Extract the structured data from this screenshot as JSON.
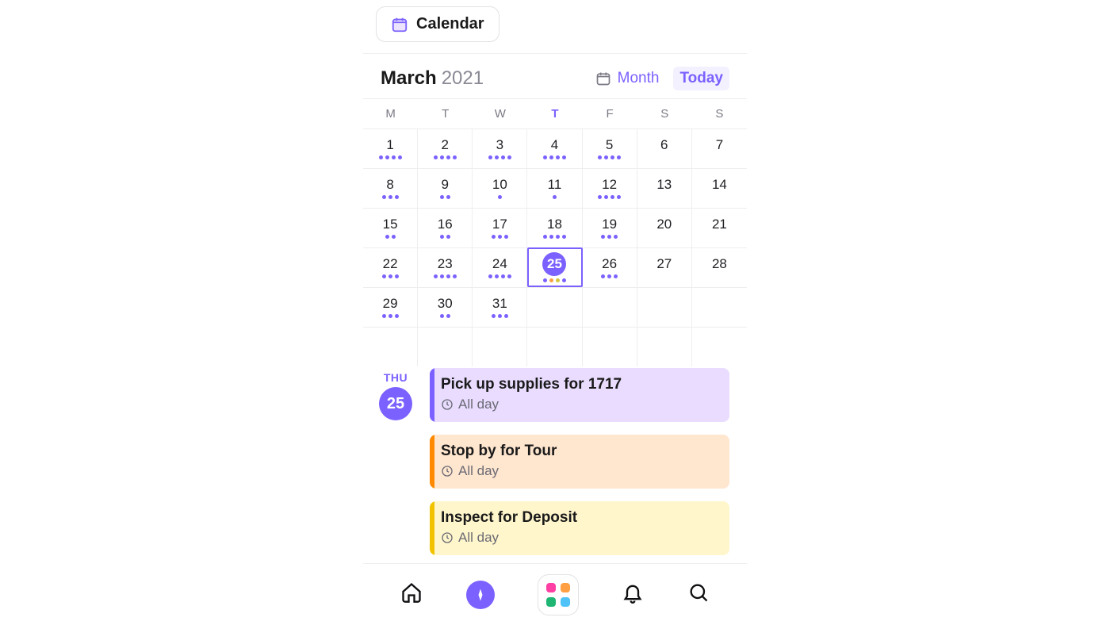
{
  "tab": {
    "label": "Calendar"
  },
  "header": {
    "month": "March",
    "year": "2021",
    "view_label": "Month",
    "today_label": "Today"
  },
  "weekdays": [
    "M",
    "T",
    "W",
    "T",
    "F",
    "S",
    "S"
  ],
  "today_weekday_index": 3,
  "selected_day": 25,
  "days": [
    {
      "n": 1,
      "dots": [
        "p",
        "p",
        "p",
        "p"
      ]
    },
    {
      "n": 2,
      "dots": [
        "p",
        "p",
        "p",
        "p"
      ]
    },
    {
      "n": 3,
      "dots": [
        "p",
        "p",
        "p",
        "p"
      ]
    },
    {
      "n": 4,
      "dots": [
        "p",
        "p",
        "p",
        "p"
      ]
    },
    {
      "n": 5,
      "dots": [
        "p",
        "p",
        "p",
        "p"
      ]
    },
    {
      "n": 6,
      "dots": []
    },
    {
      "n": 7,
      "dots": []
    },
    {
      "n": 8,
      "dots": [
        "p",
        "p",
        "p"
      ]
    },
    {
      "n": 9,
      "dots": [
        "p",
        "p"
      ]
    },
    {
      "n": 10,
      "dots": [
        "p"
      ]
    },
    {
      "n": 11,
      "dots": [
        "p"
      ]
    },
    {
      "n": 12,
      "dots": [
        "p",
        "p",
        "p",
        "p"
      ]
    },
    {
      "n": 13,
      "dots": []
    },
    {
      "n": 14,
      "dots": []
    },
    {
      "n": 15,
      "dots": [
        "p",
        "p"
      ]
    },
    {
      "n": 16,
      "dots": [
        "p",
        "p"
      ]
    },
    {
      "n": 17,
      "dots": [
        "p",
        "p",
        "p"
      ]
    },
    {
      "n": 18,
      "dots": [
        "p",
        "p",
        "p",
        "p"
      ]
    },
    {
      "n": 19,
      "dots": [
        "p",
        "p",
        "p"
      ]
    },
    {
      "n": 20,
      "dots": []
    },
    {
      "n": 21,
      "dots": []
    },
    {
      "n": 22,
      "dots": [
        "p",
        "p",
        "p"
      ]
    },
    {
      "n": 23,
      "dots": [
        "p",
        "p",
        "p",
        "p"
      ]
    },
    {
      "n": 24,
      "dots": [
        "p",
        "p",
        "p",
        "p"
      ]
    },
    {
      "n": 25,
      "dots": [
        "p",
        "o",
        "y",
        "p"
      ]
    },
    {
      "n": 26,
      "dots": [
        "p",
        "p",
        "p"
      ]
    },
    {
      "n": 27,
      "dots": []
    },
    {
      "n": 28,
      "dots": []
    },
    {
      "n": 29,
      "dots": [
        "p",
        "p",
        "p"
      ]
    },
    {
      "n": 30,
      "dots": [
        "p",
        "p"
      ]
    },
    {
      "n": 31,
      "dots": [
        "p",
        "p",
        "p"
      ]
    }
  ],
  "event_header": {
    "dow": "THU",
    "daynum": "25"
  },
  "events": [
    {
      "title": "Pick up supplies for 1717",
      "time": "All day",
      "color": "purple"
    },
    {
      "title": "Stop by for Tour",
      "time": "All day",
      "color": "orange"
    },
    {
      "title": "Inspect for Deposit",
      "time": "All day",
      "color": "yellow"
    }
  ],
  "nav": {
    "items": [
      "home",
      "explore",
      "apps",
      "alerts",
      "search"
    ]
  }
}
